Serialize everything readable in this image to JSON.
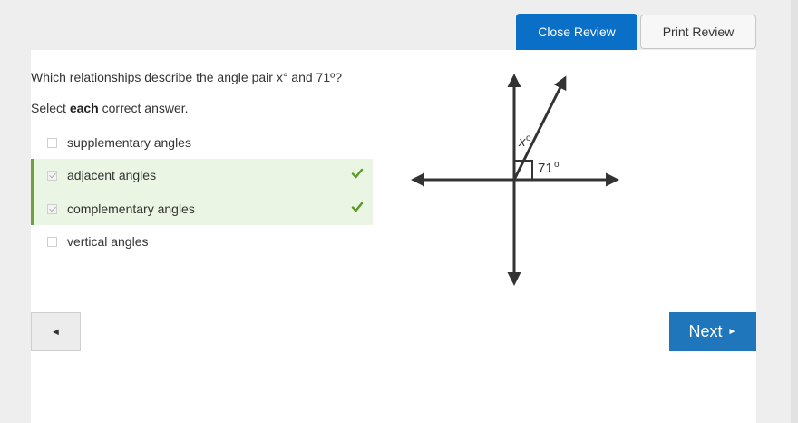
{
  "header": {
    "close_review_label": "Close Review",
    "print_review_label": "Print Review"
  },
  "question": {
    "prompt": "Which relationships describe the angle pair x° and 71º?",
    "instruction_prefix": "Select ",
    "instruction_bold": "each",
    "instruction_suffix": " correct answer."
  },
  "options": [
    {
      "label": "supplementary angles",
      "selected": false,
      "correct": false
    },
    {
      "label": "adjacent angles",
      "selected": true,
      "correct": true
    },
    {
      "label": "complementary angles",
      "selected": true,
      "correct": true
    },
    {
      "label": "vertical angles",
      "selected": false,
      "correct": false
    }
  ],
  "figure": {
    "x_label": "x",
    "angle_label": "71",
    "degree_symbol": "o"
  },
  "navigation": {
    "prev_label": "◄",
    "next_label": "Next",
    "next_arrow": "►"
  },
  "colors": {
    "primary": "#0a6fc7",
    "next_button": "#1f76bb",
    "correct_bg": "#eaf5e3",
    "correct_bar": "#6aa43a",
    "check": "#5a9a2a"
  }
}
